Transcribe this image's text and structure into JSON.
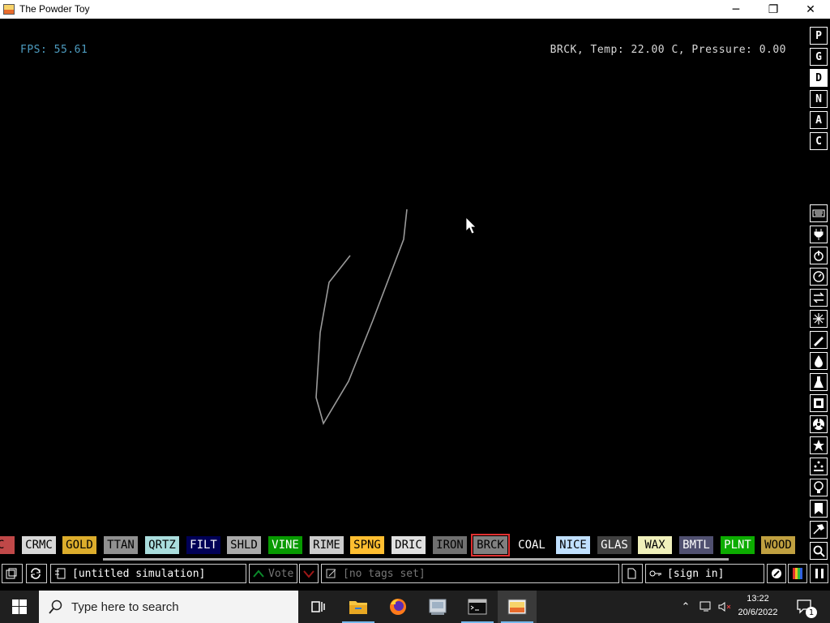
{
  "window": {
    "title": "The Powder Toy",
    "minimize_glyph": "─",
    "maximize_glyph": "❐",
    "close_glyph": "✕"
  },
  "hud": {
    "fps": "FPS: 55.61",
    "status": "BRCK, Temp: 22.00 C, Pressure: 0.00"
  },
  "sidebar_letters": [
    "P",
    "G",
    "D",
    "N",
    "A",
    "C"
  ],
  "sidebar_tools": [
    "keyboard-icon",
    "plug-icon",
    "power-icon",
    "gauge-icon",
    "arrows-icon",
    "sparkle-icon",
    "pencil-icon",
    "drop-icon",
    "flask-icon",
    "square-icon",
    "radiation-icon",
    "star-icon",
    "dots-icon",
    "bulb-icon",
    "bookmark-icon",
    "hammer-icon",
    "magnifier-icon"
  ],
  "palette": [
    {
      "label": "AC",
      "bg": "#c04848",
      "fg": "#000000"
    },
    {
      "label": "CRMC",
      "bg": "#d8d8d8",
      "fg": "#000000"
    },
    {
      "label": "GOLD",
      "bg": "#dcad2c",
      "fg": "#000000"
    },
    {
      "label": "TTAN",
      "bg": "#909090",
      "fg": "#000000"
    },
    {
      "label": "QRTZ",
      "bg": "#aadddd",
      "fg": "#000000"
    },
    {
      "label": "FILT",
      "bg": "#000056",
      "fg": "#ffffff"
    },
    {
      "label": "SHLD",
      "bg": "#aaaaaa",
      "fg": "#000000"
    },
    {
      "label": "VINE",
      "bg": "#079a00",
      "fg": "#ffffff"
    },
    {
      "label": "RIME",
      "bg": "#cccccc",
      "fg": "#000000"
    },
    {
      "label": "SPNG",
      "bg": "#ffbe30",
      "fg": "#000000"
    },
    {
      "label": "DRIC",
      "bg": "#e0e0e0",
      "fg": "#000000"
    },
    {
      "label": "IRON",
      "bg": "#707070",
      "fg": "#000000"
    },
    {
      "label": "BRCK",
      "bg": "#808080",
      "fg": "#000000",
      "selected": true
    },
    {
      "label": "COAL",
      "bg": "#000000",
      "fg": "#ffffff"
    },
    {
      "label": "NICE",
      "bg": "#c0e0ff",
      "fg": "#000000"
    },
    {
      "label": "GLAS",
      "bg": "#404040",
      "fg": "#ffffff"
    },
    {
      "label": "WAX",
      "bg": "#f0f0bb",
      "fg": "#000000"
    },
    {
      "label": "BMTL",
      "bg": "#505070",
      "fg": "#ffffff"
    },
    {
      "label": "PLNT",
      "bg": "#0cac00",
      "fg": "#ffffff"
    },
    {
      "label": "WOOD",
      "bg": "#c0a040",
      "fg": "#000000"
    }
  ],
  "bottombar": {
    "save_title": "[untitled simulation]",
    "vote_label": "Vote",
    "tags": "[no tags set]",
    "sign_in": "[sign in]"
  },
  "taskbar": {
    "search_placeholder": "Type here to search",
    "time": "13:22",
    "date": "20/6/2022",
    "notification_count": "1",
    "tray_chevron": "⌃"
  },
  "colors": {
    "hud_fps": "#4d9cc0",
    "drawing_stroke": "#9a9a9a",
    "selection_outline": "#e03030",
    "taskbar_bg": "#1f1f1f"
  }
}
